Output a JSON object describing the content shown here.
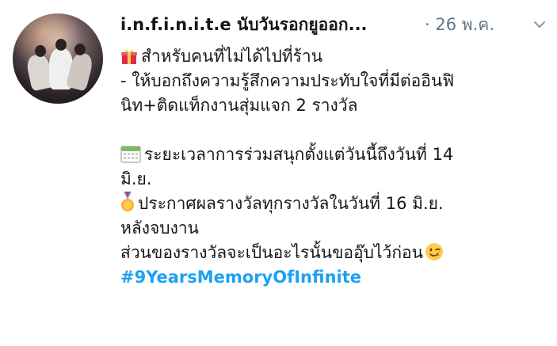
{
  "tweet": {
    "author_name": "i.n.f.i.n.i.t.e นับวันรอกยูออก...",
    "date": "· 26 พ.ค.",
    "menu_icon": "chevron-down-icon",
    "avatar_icon": "avatar-photo",
    "lines": {
      "l1": "สำหรับคนที่ไม่ได้ไปที่ร้าน",
      "l2": "- ให้บอกถึงความรู้สึกความประทับใจที่มีต่ออินฟิ",
      "l3": "นิท+ติดแท็กงานสุ่มแจก 2 รางวัล",
      "l4": "ระยะเวลาการร่วมสนุกตั้งแต่วันนี้ถึงวันที่ 14",
      "l5": "มิ.ย.",
      "l6": "ประกาศผลรางวัลทุกรางวัลในวันที่ 16 มิ.ย.",
      "l7": "หลังจบงาน",
      "l8": "ส่วนของรางวัลจะเป็นอะไรนั้นขออุ๊บไว้ก่อน"
    },
    "emojis": {
      "gift": "gift-icon",
      "calendar": "calendar-icon",
      "medal": "medal-icon",
      "wink": "winking-face-icon"
    },
    "hashtag": "#9YearsMemoryOfInfinite",
    "colors": {
      "hashtag": "#1da1f2",
      "muted": "#657786",
      "text": "#14171a"
    }
  }
}
